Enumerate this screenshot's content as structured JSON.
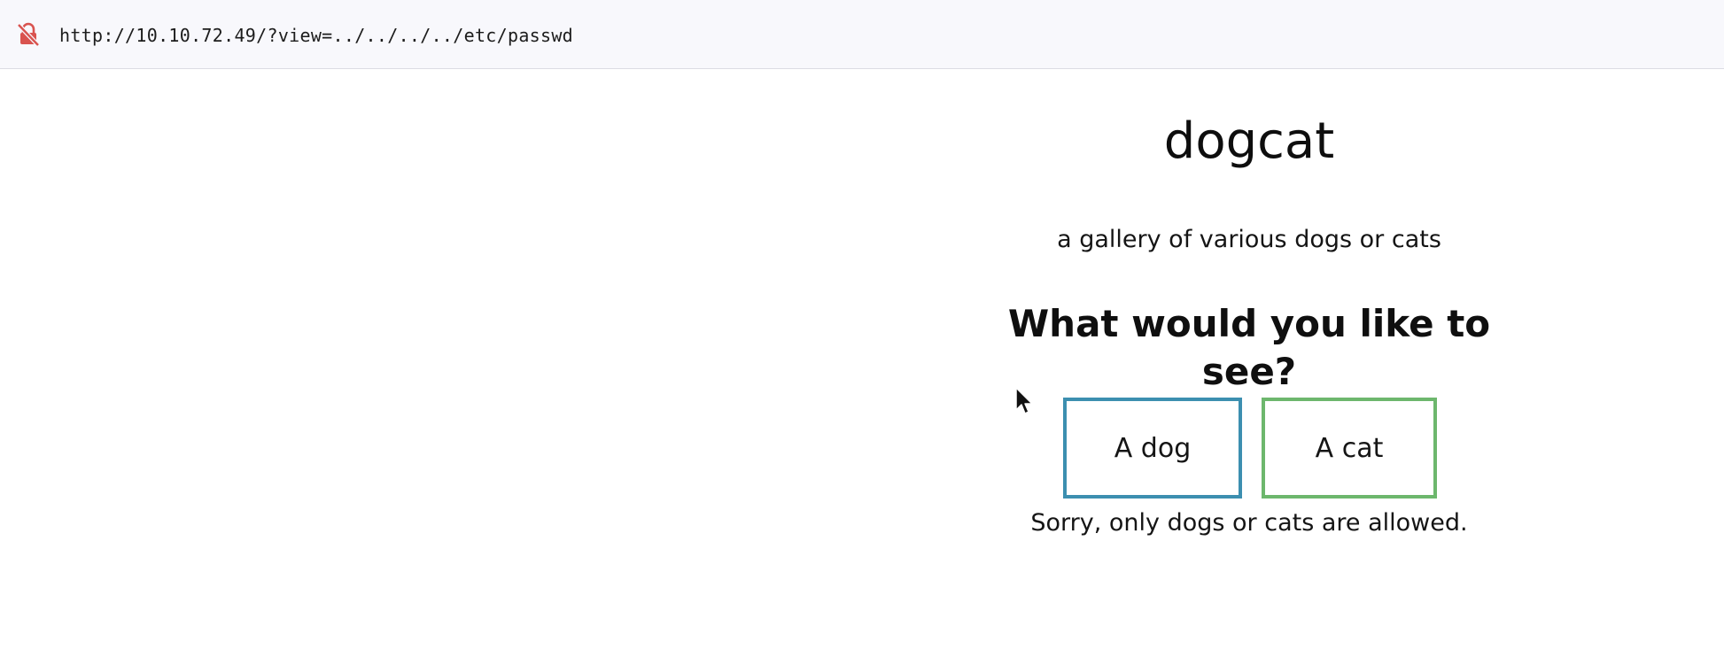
{
  "address_bar": {
    "url": "http://10.10.72.49/?view=../../../../etc/passwd",
    "security_icon": "insecure-lock-icon",
    "security_icon_color": "#d9534f"
  },
  "page": {
    "title": "dogcat",
    "subtitle": "a gallery of various dogs or cats",
    "question": "What would you like to see?",
    "buttons": [
      {
        "label": "A dog",
        "border_color": "#3c8fb0"
      },
      {
        "label": "A cat",
        "border_color": "#6db76d"
      }
    ],
    "message": "Sorry, only dogs or cats are allowed."
  },
  "cursor": {
    "icon": "mouse-pointer-icon"
  }
}
